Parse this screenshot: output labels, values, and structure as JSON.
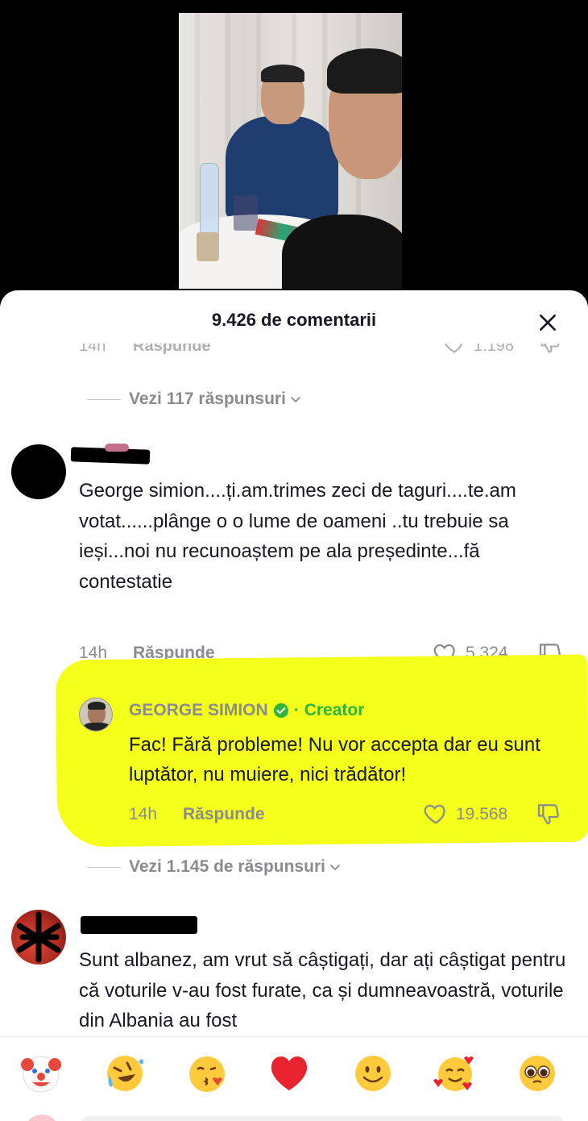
{
  "header": {
    "comment_count_title": "9.426 de comentarii"
  },
  "previous_comment": {
    "time": "14h",
    "reply_label": "Răspunde",
    "likes": "1.198",
    "view_replies": "Vezi 117 răspunsuri"
  },
  "comment_1": {
    "text": "George simion....ți.am.trimes zeci de taguri....te.am votat......plânge o o lume de oameni ..tu trebuie sa ieși...noi nu recunoaștem pe ala președinte...fă contestatie",
    "time": "14h",
    "reply_label": "Răspunde",
    "likes": "5.324"
  },
  "creator_reply": {
    "author": "GEORGE SIMION",
    "separator": "·",
    "badge": "Creator",
    "text": "Fac! Fără probleme! Nu vor accepta dar eu sunt luptător, nu muiere, nici trădător!",
    "time": "14h",
    "reply_label": "Răspunde",
    "likes": "19.568",
    "highlight_color": "#f4ff1a",
    "creator_color": "#2fb43c"
  },
  "comment_1_view_replies": "Vezi 1.145 de răspunsuri",
  "comment_2": {
    "text": "Sunt albanez, am vrut să câștigați, dar ați câștigat pentru că voturile v-au fost furate, ca și dumneavoastră, voturile din Albania au fost"
  },
  "emoji_bar": [
    "clown-face",
    "rolling-laughing-face",
    "kissing-face",
    "red-heart",
    "slightly-smiling-face",
    "smiling-face-with-hearts",
    "pleading-face"
  ]
}
